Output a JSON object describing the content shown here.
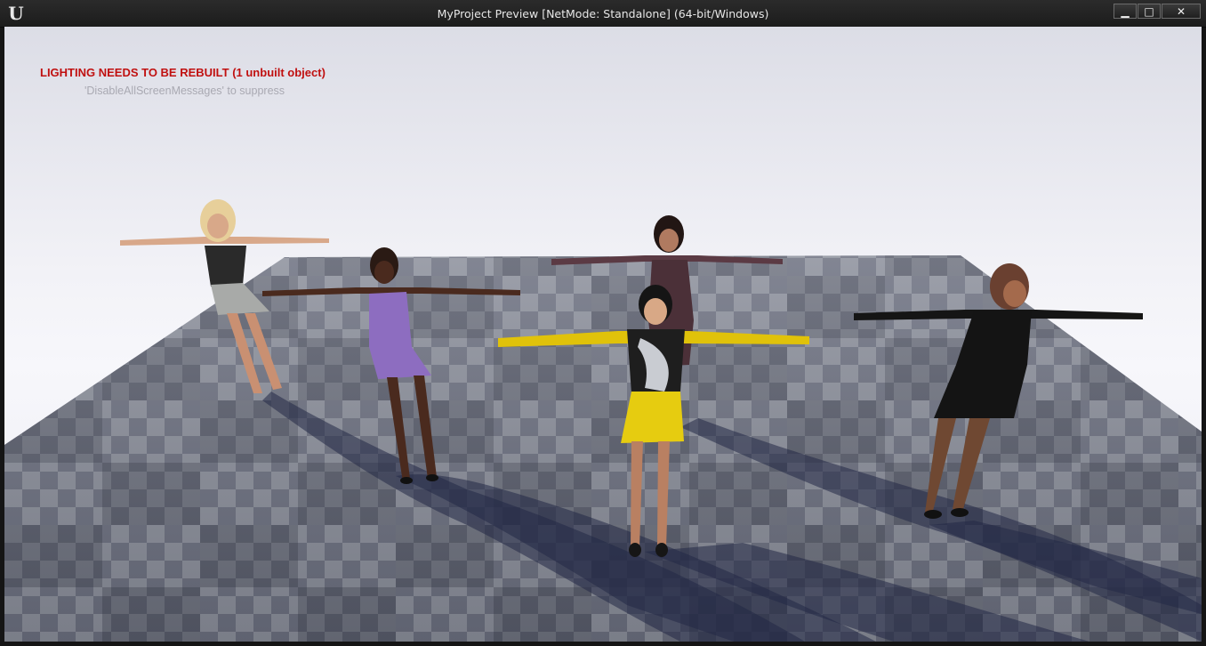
{
  "window": {
    "title": "MyProject Preview [NetMode: Standalone]  (64-bit/Windows)",
    "logo_icon": "unreal-engine-logo-icon",
    "logo_glyph": "U",
    "controls": {
      "minimize_glyph": "▁",
      "maximize_glyph": "□",
      "close_glyph": "✕"
    }
  },
  "viewport": {
    "messages": {
      "warning": "LIGHTING NEEDS TO BE REBUILT (1 unbuilt object)",
      "hint": "'DisableAllScreenMessages' to suppress"
    },
    "colors": {
      "warning": "#c01010",
      "hint": "#a9a9b2",
      "sky": "#f2f2f7",
      "floor_dark": "#5b5f6c",
      "floor_light": "#8a8e9a"
    }
  }
}
